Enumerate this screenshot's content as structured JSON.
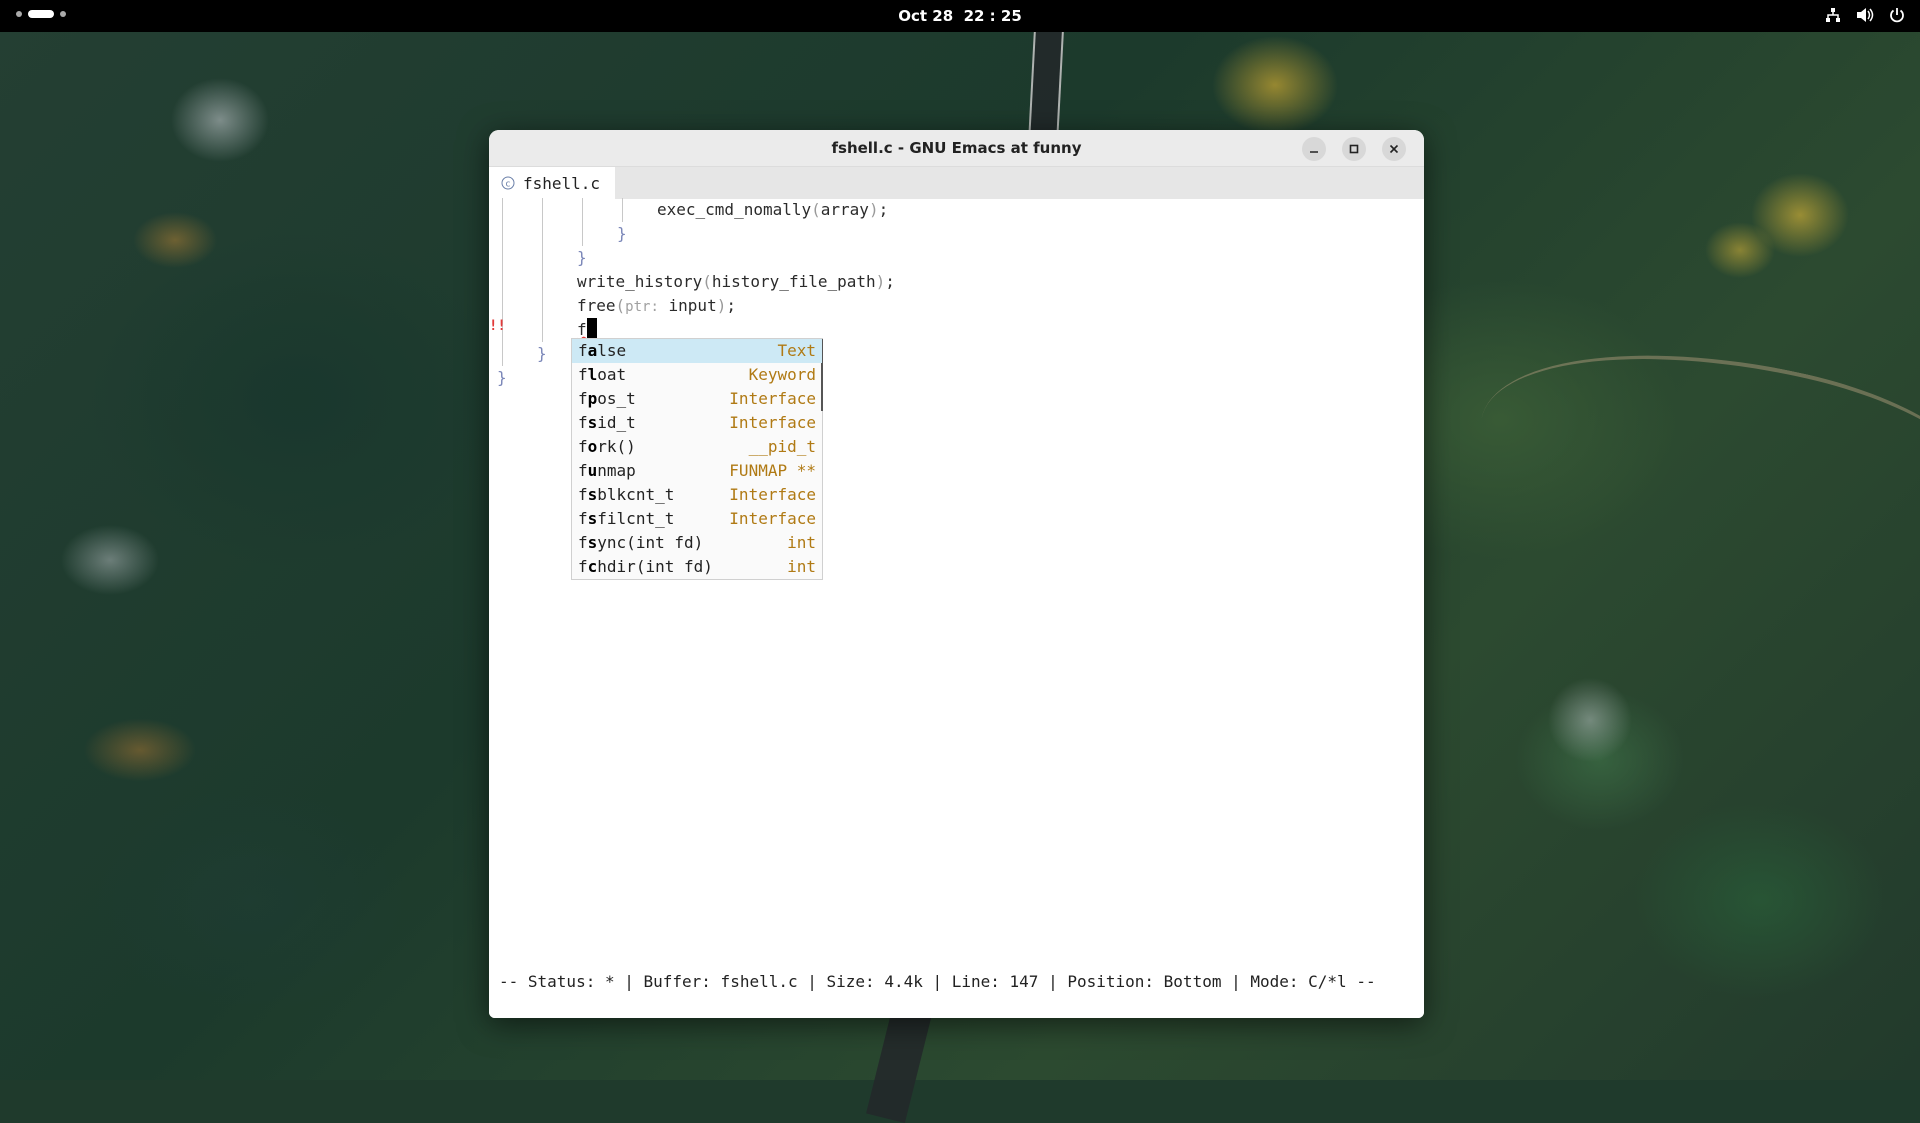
{
  "desktop": {
    "clock": "Oct 28  22 : 25",
    "tray_icons": [
      "network-icon",
      "volume-icon",
      "power-icon"
    ]
  },
  "window": {
    "title": "fshell.c - GNU Emacs at funny",
    "tab": {
      "icon": "c",
      "label": "fshell.c"
    }
  },
  "code": {
    "line1_func": "exec_cmd_nomally",
    "line1_arg": "array",
    "line4_func": "write_history",
    "line4_arg": "history_file_path",
    "line5_func": "free",
    "line5_hint": "ptr:",
    "line5_arg": "input",
    "line6_typed": "f"
  },
  "completion": {
    "selected_index": 0,
    "items": [
      {
        "prefix": "f",
        "match": "a",
        "rest": "lse",
        "kind": "Text"
      },
      {
        "prefix": "f",
        "match": "l",
        "rest": "oat",
        "kind": "Keyword"
      },
      {
        "prefix": "f",
        "match": "p",
        "rest": "os_t",
        "kind": "Interface"
      },
      {
        "prefix": "f",
        "match": "s",
        "rest": "id_t",
        "kind": "Interface"
      },
      {
        "prefix": "f",
        "match": "o",
        "rest": "rk()",
        "kind": "__pid_t"
      },
      {
        "prefix": "f",
        "match": "u",
        "rest": "nmap",
        "kind": "FUNMAP **"
      },
      {
        "prefix": "f",
        "match": "s",
        "rest": "blkcnt_t",
        "kind": "Interface"
      },
      {
        "prefix": "f",
        "match": "s",
        "rest": "filcnt_t",
        "kind": "Interface"
      },
      {
        "prefix": "f",
        "match": "s",
        "rest": "ync(int fd)",
        "kind": "int"
      },
      {
        "prefix": "f",
        "match": "c",
        "rest": "hdir(int fd)",
        "kind": "int"
      }
    ]
  },
  "modeline": {
    "text": "-- Status: * | Buffer: fshell.c | Size: 4.4k | Line: 147 | Position: Bottom | Mode: C/*l --"
  },
  "colors": {
    "selection": "#cde9f5",
    "kind": "#b07a14",
    "brace": "#7a86b8",
    "error_mark": "#e23a3a"
  }
}
